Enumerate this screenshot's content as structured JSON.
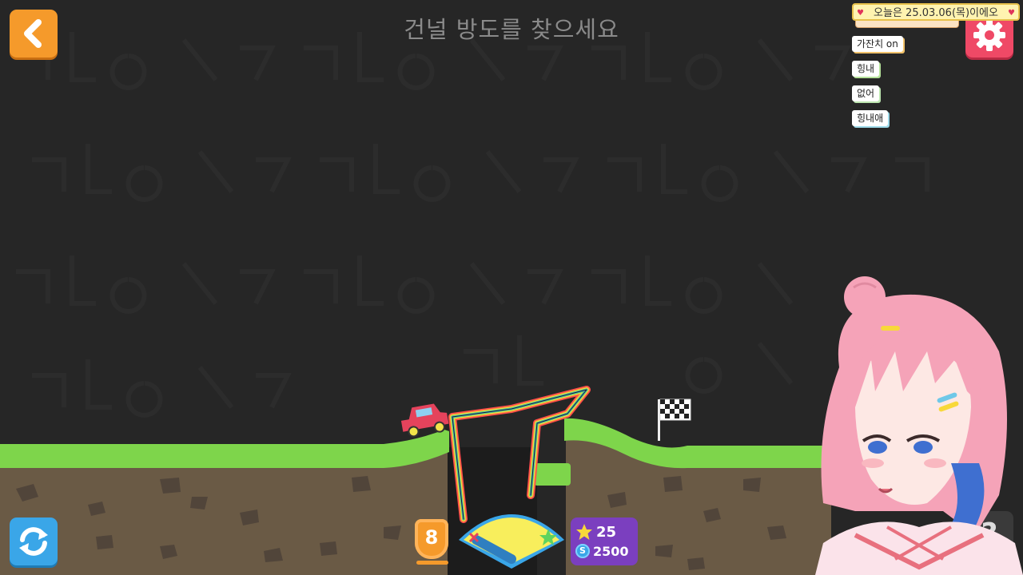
{
  "title": "건널 방도를 찾으세요",
  "notice": "오늘은 25.03.06(목)이에오",
  "chips": [
    "가잔치 on",
    "힝내",
    "없어",
    "힝내애"
  ],
  "level": "8",
  "stars": "25",
  "coins": "2500",
  "coin_symbol": "S",
  "help_label": "?",
  "icons": {
    "back": "back-arrow-icon",
    "settings": "gear-icon",
    "restart": "restart-arrows-icon",
    "star": "star-icon",
    "coin": "coin-icon",
    "heart": "heart-icon",
    "flag": "checkered-flag-icon",
    "car": "red-car-icon"
  },
  "colors": {
    "background": "#262626",
    "grass": "#7ed54b",
    "dirt": "#6a5a45",
    "back_button": "#f59a2b",
    "settings_button": "#ef4966",
    "restart_button": "#3aa6e8",
    "score_panel": "#7b3fbf",
    "gauge": "#f8ee5c"
  }
}
